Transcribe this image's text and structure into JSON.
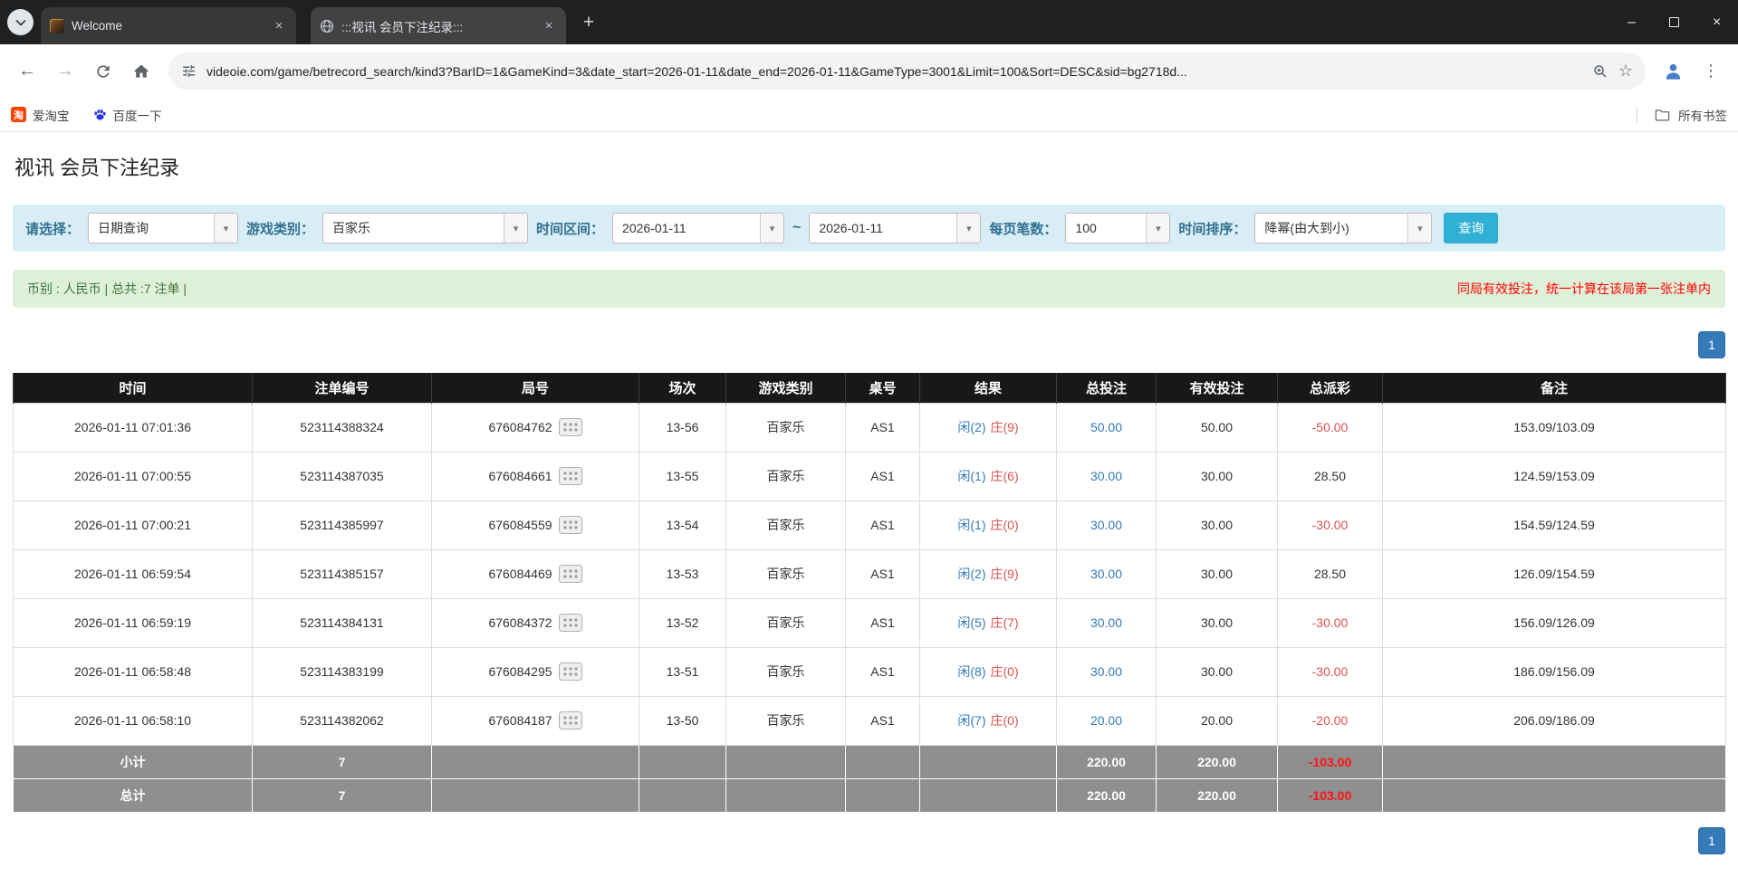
{
  "icons": {
    "back": "←",
    "forward": "→",
    "menu": "⋮",
    "star": "☆",
    "caret": "▾",
    "close": "×",
    "plus": "+",
    "minimize": "–"
  },
  "colors": {
    "accent_blue": "#337ab7",
    "negative_red": "#d9534f",
    "filter_bg": "#d9edf7",
    "summary_bg": "#dff0d8"
  },
  "browser": {
    "tabs": [
      {
        "title": "Welcome"
      },
      {
        "title": ":::视讯 会员下注纪录:::"
      }
    ],
    "url": "videoie.com/game/betrecord_search/kind3?BarID=1&GameKind=3&date_start=2026-01-11&date_end=2026-01-11&GameType=3001&Limit=100&Sort=DESC&sid=bg2718d...",
    "bookmarks": {
      "item1": "爱淘宝",
      "item1_icon": "淘",
      "item2": "百度一下",
      "all_bookmarks": "所有书签"
    }
  },
  "page": {
    "title": "视讯 会员下注纪录",
    "filters": {
      "select_label": "请选择：",
      "select_value": "日期查询",
      "game_label": "游戏类别：",
      "game_value": "百家乐",
      "range_label": "时间区间：",
      "date_start": "2026-01-11",
      "range_separator": "~",
      "date_end": "2026-01-11",
      "page_size_label": "每页笔数：",
      "page_size_value": "100",
      "sort_label": "时间排序：",
      "sort_value": "降幂(由大到小)",
      "search_button": "查询"
    },
    "summary": {
      "left": "币别 : 人民币 | 总共 :7 注单 |",
      "right": "同局有效投注，统一计算在该局第一张注单内"
    },
    "pagination": {
      "page": "1"
    },
    "table": {
      "headers": [
        "时间",
        "注单编号",
        "局号",
        "场次",
        "游戏类别",
        "桌号",
        "结果",
        "总投注",
        "有效投注",
        "总派彩",
        "备注"
      ],
      "rows": [
        {
          "time": "2026-01-11 07:01:36",
          "bet_id": "523114388324",
          "round": "676084762",
          "session": "13-56",
          "game": "百家乐",
          "table_no": "AS1",
          "result_player": "闲(2)",
          "result_banker": "庄(9)",
          "total_bet": "50.00",
          "valid_bet": "50.00",
          "payout": "-50.00",
          "note": "153.09/103.09"
        },
        {
          "time": "2026-01-11 07:00:55",
          "bet_id": "523114387035",
          "round": "676084661",
          "session": "13-55",
          "game": "百家乐",
          "table_no": "AS1",
          "result_player": "闲(1)",
          "result_banker": "庄(6)",
          "total_bet": "30.00",
          "valid_bet": "30.00",
          "payout": "28.50",
          "note": "124.59/153.09"
        },
        {
          "time": "2026-01-11 07:00:21",
          "bet_id": "523114385997",
          "round": "676084559",
          "session": "13-54",
          "game": "百家乐",
          "table_no": "AS1",
          "result_player": "闲(1)",
          "result_banker": "庄(0)",
          "total_bet": "30.00",
          "valid_bet": "30.00",
          "payout": "-30.00",
          "note": "154.59/124.59"
        },
        {
          "time": "2026-01-11 06:59:54",
          "bet_id": "523114385157",
          "round": "676084469",
          "session": "13-53",
          "game": "百家乐",
          "table_no": "AS1",
          "result_player": "闲(2)",
          "result_banker": "庄(9)",
          "total_bet": "30.00",
          "valid_bet": "30.00",
          "payout": "28.50",
          "note": "126.09/154.59"
        },
        {
          "time": "2026-01-11 06:59:19",
          "bet_id": "523114384131",
          "round": "676084372",
          "session": "13-52",
          "game": "百家乐",
          "table_no": "AS1",
          "result_player": "闲(5)",
          "result_banker": "庄(7)",
          "total_bet": "30.00",
          "valid_bet": "30.00",
          "payout": "-30.00",
          "note": "156.09/126.09"
        },
        {
          "time": "2026-01-11 06:58:48",
          "bet_id": "523114383199",
          "round": "676084295",
          "session": "13-51",
          "game": "百家乐",
          "table_no": "AS1",
          "result_player": "闲(8)",
          "result_banker": "庄(0)",
          "total_bet": "30.00",
          "valid_bet": "30.00",
          "payout": "-30.00",
          "note": "186.09/156.09"
        },
        {
          "time": "2026-01-11 06:58:10",
          "bet_id": "523114382062",
          "round": "676084187",
          "session": "13-50",
          "game": "百家乐",
          "table_no": "AS1",
          "result_player": "闲(7)",
          "result_banker": "庄(0)",
          "total_bet": "20.00",
          "valid_bet": "20.00",
          "payout": "-20.00",
          "note": "206.09/186.09"
        }
      ],
      "subtotal": {
        "label": "小计",
        "count": "7",
        "total_bet": "220.00",
        "valid_bet": "220.00",
        "payout": "-103.00"
      },
      "total": {
        "label": "总计",
        "count": "7",
        "total_bet": "220.00",
        "valid_bet": "220.00",
        "payout": "-103.00"
      }
    }
  }
}
